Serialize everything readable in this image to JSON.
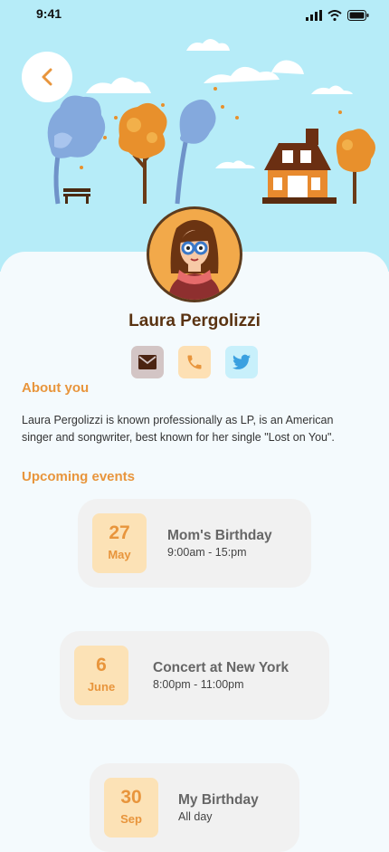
{
  "status": {
    "time": "9:41"
  },
  "profile": {
    "name": "Laura Pergolizzi"
  },
  "about": {
    "title": "About you",
    "text": "Laura Pergolizzi is known professionally as LP, is an American singer and songwriter, best known for her single \"Lost on You\"."
  },
  "events": {
    "title": "Upcoming events",
    "items": [
      {
        "day": "27",
        "month": "May",
        "title": "Mom's Birthday",
        "time": "9:00am - 15:pm"
      },
      {
        "day": "6",
        "month": "June",
        "title": "Concert at New York",
        "time": "8:00pm - 11:00pm"
      },
      {
        "day": "30",
        "month": "Sep",
        "title": "My Birthday",
        "time": "All day"
      }
    ]
  },
  "colors": {
    "accent": "#e8953c",
    "name": "#5a3312",
    "sky": "#b6ecf8"
  },
  "icons": [
    "back-chevron-icon",
    "mail-icon",
    "phone-icon",
    "twitter-icon"
  ]
}
